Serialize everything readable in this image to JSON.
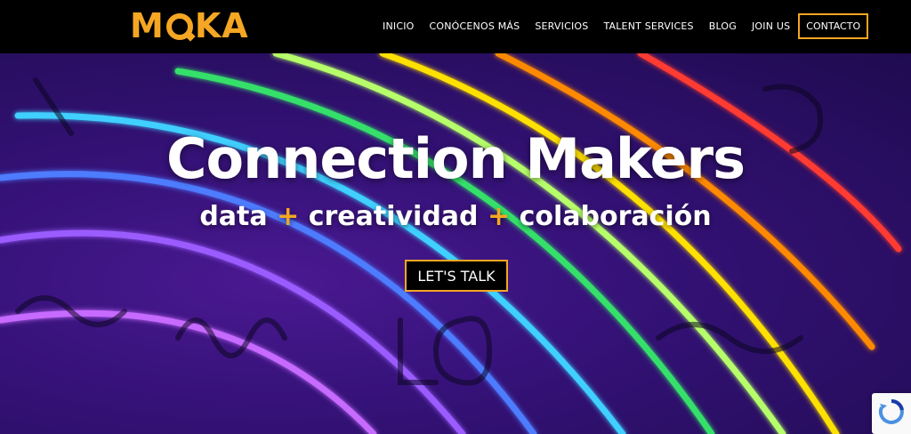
{
  "header": {
    "logo": "MOKA",
    "logo_parts": {
      "m": "M",
      "ka": "KA"
    },
    "nav": [
      {
        "label": "INICIO"
      },
      {
        "label": "CONÓCENOS MÁS"
      },
      {
        "label": "SERVICIOS"
      },
      {
        "label": "TALENT SERVICES"
      },
      {
        "label": "BLOG"
      },
      {
        "label": "JOIN US"
      }
    ],
    "cta": "CONTACTO"
  },
  "hero": {
    "title": "Connection Makers",
    "subtitle_parts": [
      "data",
      "+",
      "creatividad",
      "+",
      "colaboración"
    ],
    "button": "LET'S TALK"
  },
  "colors": {
    "accent": "#f5a623",
    "background": "#000000",
    "text": "#ffffff"
  },
  "icons": {
    "recaptcha": "recaptcha-badge-icon"
  }
}
